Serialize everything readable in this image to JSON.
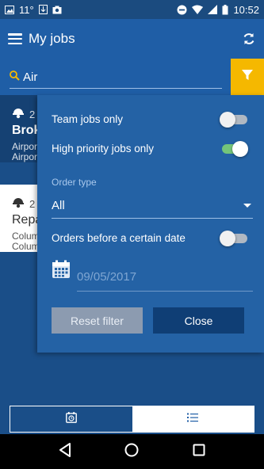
{
  "status_bar": {
    "temperature": "11°",
    "time": "10:52"
  },
  "app_bar": {
    "title": "My jobs"
  },
  "search": {
    "value": "Air"
  },
  "jobs": [
    {
      "number": "2",
      "title": "Brok",
      "line1": "Airpor",
      "line2": "Airpor"
    },
    {
      "number": "2",
      "title": "Repa",
      "line1": "Colum",
      "line2": "Colum"
    }
  ],
  "filter": {
    "team_jobs_label": "Team jobs only",
    "team_jobs_on": false,
    "high_priority_label": "High priority jobs only",
    "high_priority_on": true,
    "order_type_label": "Order type",
    "order_type_value": "All",
    "before_date_label": "Orders before a certain date",
    "before_date_on": false,
    "date_value": "09/05/2017",
    "reset_label": "Reset filter",
    "close_label": "Close"
  },
  "colors": {
    "accent": "#f5b800",
    "toggle_on": "#74c57a",
    "primary": "#1f5ea6"
  }
}
